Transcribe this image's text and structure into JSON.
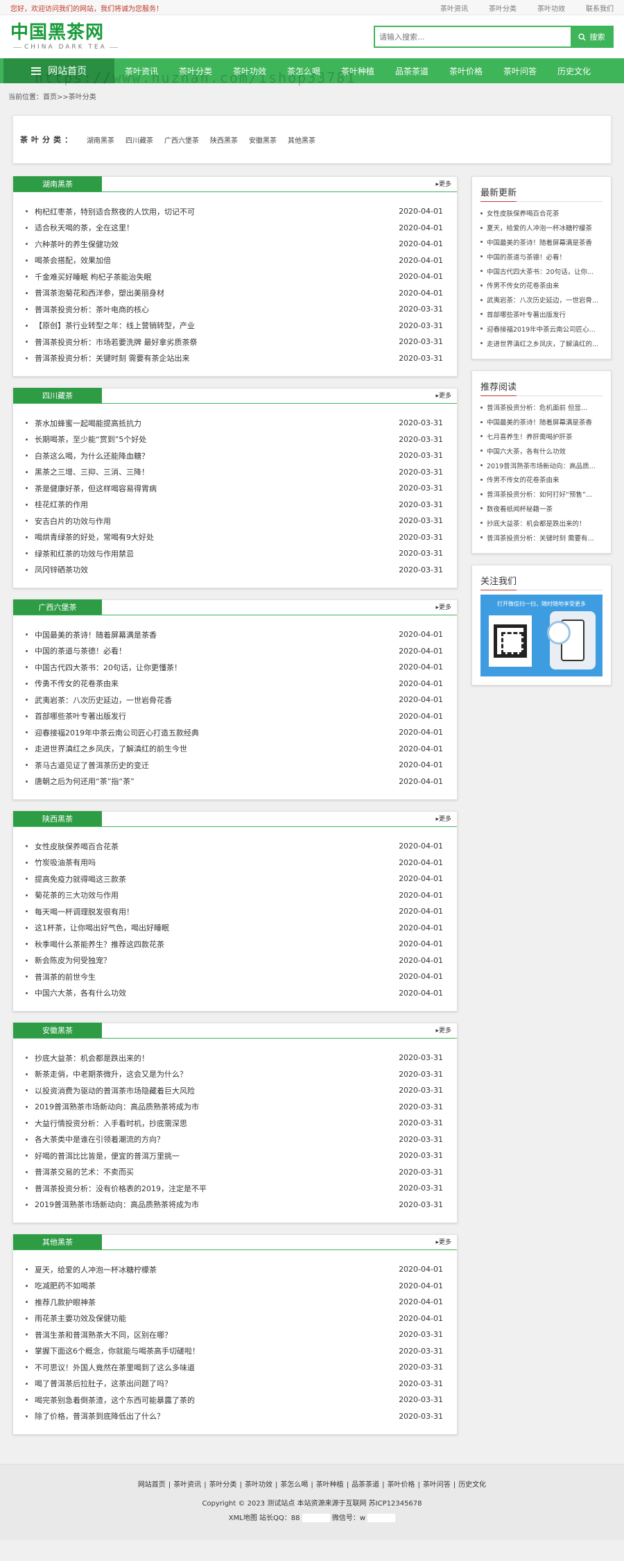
{
  "topbar": {
    "welcome": "您好，欢迎访问我们的网站，我们将诚为您服务！",
    "links": [
      "茶叶资讯",
      "茶叶分类",
      "茶叶功效",
      "联系我们"
    ]
  },
  "header": {
    "logo_cn": "中国黑茶网",
    "logo_en": "CHINA DARK TEA",
    "search_placeholder": "请输入搜索...",
    "search_button": "搜索"
  },
  "nav": {
    "home": "网站首页",
    "items": [
      "茶叶资讯",
      "茶叶分类",
      "茶叶功效",
      "茶怎么喝",
      "茶叶种植",
      "品茶茶道",
      "茶叶价格",
      "茶叶问答",
      "历史文化"
    ]
  },
  "watermark": "https://www.huzhan.com/ishop33781",
  "breadcrumb": "当前位置：首页>>茶叶分类",
  "categories": {
    "label": "茶叶分类：",
    "items": [
      "湖南黑茶",
      "四川藏茶",
      "广西六堡茶",
      "陕西黑茶",
      "安徽黑茶",
      "其他黑茶"
    ]
  },
  "more_label": "更多",
  "panels": [
    {
      "title": "湖南黑茶",
      "rows": [
        {
          "t": "枸杞红枣茶，特别适合熬夜的人饮用，切记不可",
          "d": "2020-04-01"
        },
        {
          "t": "适合秋天喝的茶，全在这里！",
          "d": "2020-04-01"
        },
        {
          "t": "六种茶叶的养生保健功效",
          "d": "2020-04-01"
        },
        {
          "t": "喝茶会搭配，效果加倍",
          "d": "2020-04-01"
        },
        {
          "t": "千金难买好睡眠 枸杞子茶能治失眠",
          "d": "2020-04-01"
        },
        {
          "t": "普洱茶泡菊花和西洋参，塑出美丽身材",
          "d": "2020-04-01"
        },
        {
          "t": "普洱茶投资分析：茶叶电商的核心",
          "d": "2020-03-31"
        },
        {
          "t": "【原创】茶行业转型之年：线上营销转型，产业",
          "d": "2020-03-31"
        },
        {
          "t": "普洱茶投资分析：市场若要洗牌 最好拿劣质茶祭",
          "d": "2020-03-31"
        },
        {
          "t": "普洱茶投资分析：关键时刻 需要有茶企站出来",
          "d": "2020-03-31"
        }
      ]
    },
    {
      "title": "四川藏茶",
      "rows": [
        {
          "t": "茶水加蜂蜜一起喝能提高抵抗力",
          "d": "2020-03-31"
        },
        {
          "t": "长期喝茶，至少能“赏到”5个好处",
          "d": "2020-03-31"
        },
        {
          "t": "白茶这么喝，为什么还能降血糖？",
          "d": "2020-03-31"
        },
        {
          "t": "黑茶之三增、三抑、三消、三降！",
          "d": "2020-03-31"
        },
        {
          "t": "茶是健康好茶，但这样喝容易得胃病",
          "d": "2020-03-31"
        },
        {
          "t": "桂花红茶的作用",
          "d": "2020-03-31"
        },
        {
          "t": "安吉白片的功效与作用",
          "d": "2020-03-31"
        },
        {
          "t": "喝烘青绿茶的好处，常喝有9大好处",
          "d": "2020-03-31"
        },
        {
          "t": "绿茶和红茶的功效与作用禁忌",
          "d": "2020-03-31"
        },
        {
          "t": "凤冈锌硒茶功效",
          "d": "2020-03-31"
        }
      ]
    },
    {
      "title": "广西六堡茶",
      "rows": [
        {
          "t": "中国最美的茶诗！随着屏幕满是茶香",
          "d": "2020-04-01"
        },
        {
          "t": "中国的茶道与茶德！必看！",
          "d": "2020-04-01"
        },
        {
          "t": "中国古代四大茶书：20句话，让你更懂茶！",
          "d": "2020-04-01"
        },
        {
          "t": "传勇不传女的花卷茶由来",
          "d": "2020-04-01"
        },
        {
          "t": "武夷岩茶：八次历史延边，一世岩骨花香",
          "d": "2020-04-01"
        },
        {
          "t": "首部哪些茶叶专著出版发行",
          "d": "2020-04-01"
        },
        {
          "t": "迎春接福2019年中茶云南公司匠心打造五款经典",
          "d": "2020-04-01"
        },
        {
          "t": "走进世界滇红之乡凤庆，了解滇红的前生今世",
          "d": "2020-04-01"
        },
        {
          "t": "茶马古道见证了普洱茶历史的变迁",
          "d": "2020-04-01"
        },
        {
          "t": "唐朝之后为何还用“茶”指“茶”",
          "d": "2020-04-01"
        }
      ]
    },
    {
      "title": "陕西黑茶",
      "rows": [
        {
          "t": "女性皮肤保养喝百合花茶",
          "d": "2020-04-01"
        },
        {
          "t": "竹炭吸油茶有用吗",
          "d": "2020-04-01"
        },
        {
          "t": "提高免疫力就得喝这三款茶",
          "d": "2020-04-01"
        },
        {
          "t": "菊花茶的三大功效与作用",
          "d": "2020-04-01"
        },
        {
          "t": "每天喝一杯调理脱发很有用！",
          "d": "2020-04-01"
        },
        {
          "t": "这1杯茶，让你喝出好气色，喝出好睡眠",
          "d": "2020-04-01"
        },
        {
          "t": "秋季喝什么茶能养生？推荐这四款花茶",
          "d": "2020-04-01"
        },
        {
          "t": "新会陈皮为何受独宠？",
          "d": "2020-04-01"
        },
        {
          "t": "普洱茶的前世今生",
          "d": "2020-04-01"
        },
        {
          "t": "中国六大茶，各有什么功效",
          "d": "2020-04-01"
        }
      ]
    },
    {
      "title": "安徽黑茶",
      "rows": [
        {
          "t": "抄底大益茶：机会都是跌出来的！",
          "d": "2020-03-31"
        },
        {
          "t": "新茶走俏，中老期茶微升，这会又是为什么？",
          "d": "2020-03-31"
        },
        {
          "t": "以投资消费为驱动的普洱茶市场隐藏着巨大风险",
          "d": "2020-03-31"
        },
        {
          "t": "2019普洱熟茶市场新动向：高品质熟茶将成为市",
          "d": "2020-03-31"
        },
        {
          "t": "大益行情投资分析：入手看时机，抄底需深思",
          "d": "2020-03-31"
        },
        {
          "t": "各大茶类中是谁在引领着潮流的方向？",
          "d": "2020-03-31"
        },
        {
          "t": "好喝的普洱比比皆是，便宜的普洱万里挑一",
          "d": "2020-03-31"
        },
        {
          "t": "普洱茶交易的艺术：不卖而买",
          "d": "2020-03-31"
        },
        {
          "t": "普洱茶投资分析：没有价格表的2019，注定是不平",
          "d": "2020-03-31"
        },
        {
          "t": "2019普洱熟茶市场新动向：高品质熟茶将成为市",
          "d": "2020-03-31"
        }
      ]
    },
    {
      "title": "其他黑茶",
      "rows": [
        {
          "t": "夏天，给爱的人冲泡一杯冰糖柠檬茶",
          "d": "2020-04-01"
        },
        {
          "t": "吃减肥药不如喝茶",
          "d": "2020-04-01"
        },
        {
          "t": "推荐几款护眼神茶",
          "d": "2020-04-01"
        },
        {
          "t": "雨花茶主要功效及保健功能",
          "d": "2020-04-01"
        },
        {
          "t": "普洱生茶和普洱熟茶大不同，区别在哪？",
          "d": "2020-03-31"
        },
        {
          "t": "掌握下面这6个概念，你就能与喝茶高手切磋啦！",
          "d": "2020-03-31"
        },
        {
          "t": "不可思议！外国人竟然在茶里喝到了这么多味道",
          "d": "2020-03-31"
        },
        {
          "t": "喝了普洱茶后拉肚子，这茶出问题了吗？",
          "d": "2020-03-31"
        },
        {
          "t": "喝完茶别急着倒茶渣，这个东西可能暴露了茶的",
          "d": "2020-03-31"
        },
        {
          "t": "除了价格，普洱茶到底降低出了什么？",
          "d": "2020-03-31"
        }
      ]
    }
  ],
  "sidebar": {
    "latest": {
      "title": "最新更新",
      "items": [
        "女性皮肤保养喝百合花茶",
        "夏天，给爱的人冲泡一杯冰糖柠檬茶",
        "中国最美的茶诗！随着屏幕满是茶香",
        "中国的茶道与茶德！必看！",
        "中国古代四大茶书：20句话，让你...",
        "传男不传女的花卷茶由来",
        "武夷岩茶：八次历史延边，一世岩骨...",
        "首部哪些茶叶专著出版发行",
        "迎春接福2019年中茶云南公司匠心...",
        "走进世界滇红之乡凤庆，了解滇红的..."
      ]
    },
    "recommend": {
      "title": "推荐阅读",
      "items": [
        "普洱茶投资分析：危机面前 但显...",
        "中国最美的茶诗！随着屏幕满是茶香",
        "七月喜养生！养肝需喝护肝茶",
        "中国六大茶，各有什么功效",
        "2019普洱熟茶市场新动向：高品质...",
        "传男不传女的花卷茶由来",
        "普洱茶投资分析：如何打好“预售”...",
        "数夜看纸闻杯秘籍一茶",
        "抄底大益茶：机会都是跌出来的！",
        "普洱茶投资分析：关键时刻 需要有..."
      ]
    },
    "follow": {
      "title": "关注我们",
      "qr_text": "打开微信扫一扫，随时随地享受更多"
    }
  },
  "footer": {
    "links": [
      "网站首页",
      "茶叶资讯",
      "茶叶分类",
      "茶叶功效",
      "茶怎么喝",
      "茶叶种植",
      "品茶茶道",
      "茶叶价格",
      "茶叶问答",
      "历史文化"
    ],
    "copyright": "Copyright © 2023 测试站点 本站资源来源于互联网 苏ICP12345678",
    "xml": "XML地图 站长QQ：88",
    "wechat": "微信号：w"
  }
}
